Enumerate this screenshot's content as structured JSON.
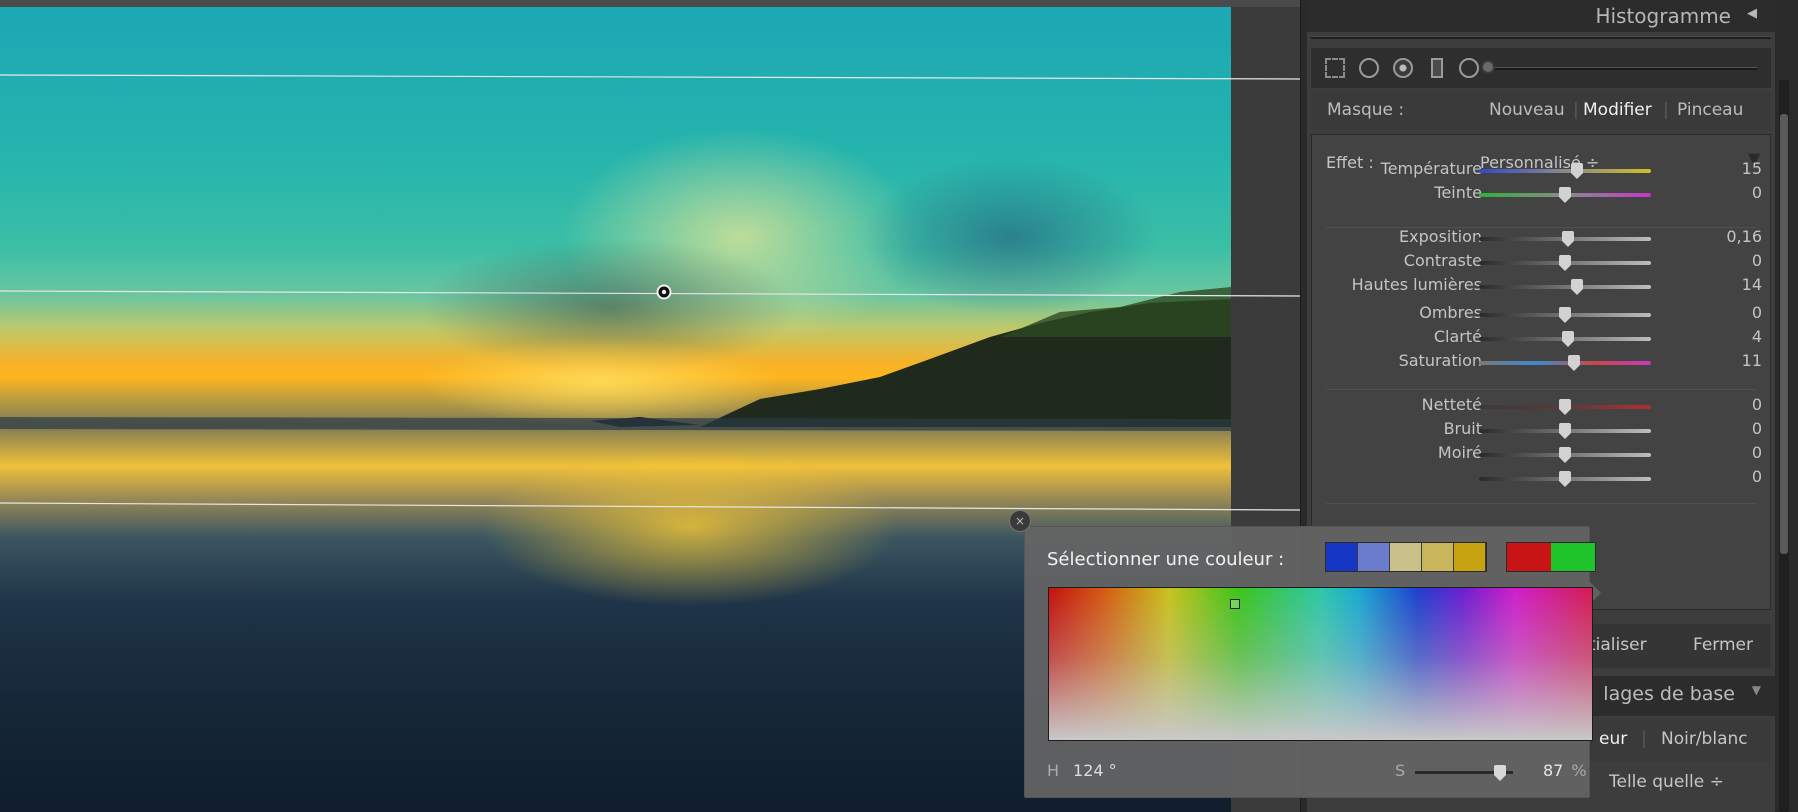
{
  "panel": {
    "histogram_title": "Histogramme",
    "mask": {
      "label": "Masque :",
      "new": "Nouveau",
      "edit": "Modifier",
      "brush": "Pinceau"
    },
    "effect": {
      "label": "Effet :",
      "value": "Personnalisé ÷"
    },
    "sliders": [
      {
        "label": "Température",
        "value": "15",
        "level": 0.57,
        "track": "temp"
      },
      {
        "label": "Teinte",
        "value": "0",
        "level": 0.5,
        "track": "tint"
      },
      {
        "label": "Exposition",
        "value": "0,16",
        "level": 0.52,
        "track": "gray"
      },
      {
        "label": "Contraste",
        "value": "0",
        "level": 0.5,
        "track": "gray"
      },
      {
        "label": "Hautes lumières",
        "value": "14",
        "level": 0.57,
        "track": "gray"
      },
      {
        "label": "Ombres",
        "value": "0",
        "level": 0.5,
        "track": "gray"
      },
      {
        "label": "Clarté",
        "value": "4",
        "level": 0.52,
        "track": "gray"
      },
      {
        "label": "Saturation",
        "value": "11",
        "level": 0.555,
        "track": "sat"
      },
      {
        "label": "Netteté",
        "value": "0",
        "level": 0.5,
        "track": "red"
      },
      {
        "label": "Bruit",
        "value": "0",
        "level": 0.5,
        "track": "gray"
      },
      {
        "label": "Moiré",
        "value": "0",
        "level": 0.5,
        "track": "gray"
      },
      {
        "label": "",
        "value": "0",
        "level": 0.5,
        "track": "gray"
      }
    ],
    "selected_color": "#1fc42a",
    "buttons": {
      "reset_partial": "tialiser",
      "close": "Fermer"
    },
    "basic_section_partial": "lages de base",
    "mode": {
      "color_partial": "eur",
      "bw": "Noir/blanc"
    },
    "wb_value": "Telle quelle ÷"
  },
  "picker": {
    "close_glyph": "×",
    "title": "Sélectionner une couleur :",
    "swatches_left": [
      "#1537c4",
      "#6b7ccc",
      "#c9c08a",
      "#c9b55b",
      "#c8a311"
    ],
    "swatches_right": [
      "#c81414",
      "#1fc42a"
    ],
    "hue_label": "H",
    "hue_value": "124",
    "hue_unit": "°",
    "sat_label": "S",
    "sat_value": "87",
    "sat_unit": "%",
    "sat_level": 0.87
  }
}
